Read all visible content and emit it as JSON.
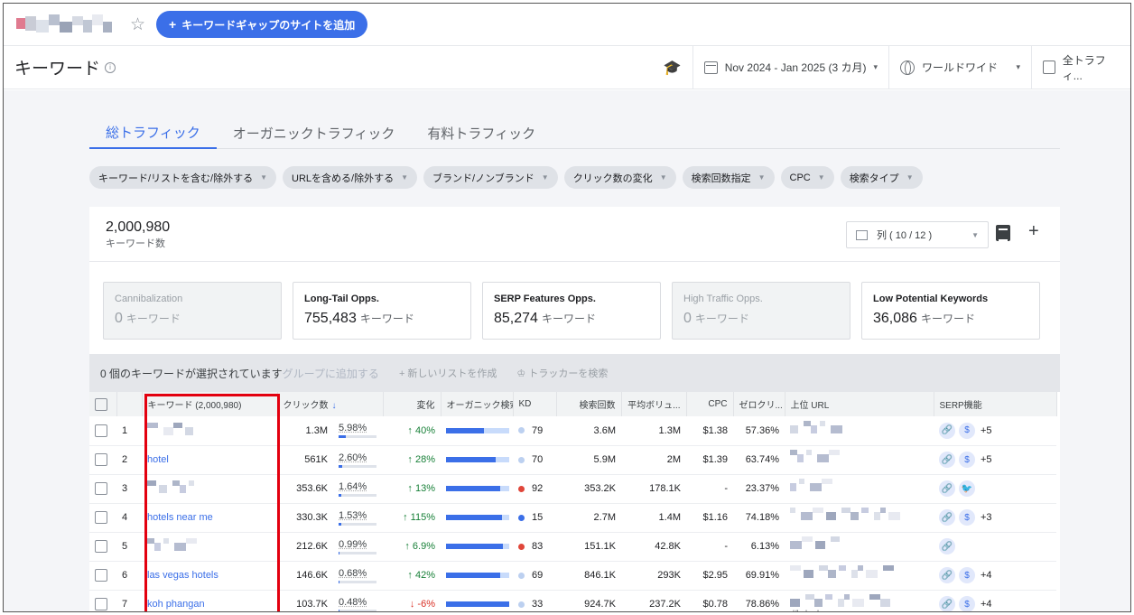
{
  "topbar": {
    "add_gap_label": "キーワードギャップのサイトを追加",
    "add_gap_plus": "+",
    "star_glyph": "☆"
  },
  "header": {
    "title": "キーワード",
    "info_glyph": "i",
    "date_range": "Nov 2024 - Jan 2025 (3 カ月)",
    "country": "ワールドワイド",
    "traffic": "全トラフィ...",
    "caret": "▾"
  },
  "tabs": [
    "総トラフィック",
    "オーガニックトラフィック",
    "有料トラフィック"
  ],
  "filters": [
    "キーワード/リストを含む/除外する",
    "URLを含める/除外する",
    "ブランド/ノンブランド",
    "クリック数の変化",
    "検索回数指定",
    "CPC",
    "検索タイプ"
  ],
  "summary": {
    "count": "2,000,980",
    "count_label": "キーワード数",
    "columns_label": "列 ( 10 / 12 )",
    "add_glyph": "+"
  },
  "opportunities": [
    {
      "title": "Cannibalization",
      "value": "0",
      "unit": "キーワード",
      "disabled": true
    },
    {
      "title": "Long-Tail Opps.",
      "value": "755,483",
      "unit": "キーワード",
      "disabled": false
    },
    {
      "title": "SERP Features Opps.",
      "value": "85,274",
      "unit": "キーワード",
      "disabled": false
    },
    {
      "title": "High Traffic Opps.",
      "value": "0",
      "unit": "キーワード",
      "disabled": true
    },
    {
      "title": "Low Potential Keywords",
      "value": "36,086",
      "unit": "キーワード",
      "disabled": false
    }
  ],
  "selection": {
    "text": "0 個のキーワードが選択されています",
    "group_add": "グループに追加する",
    "new_list": "+ 新しいリストを作成",
    "tracker": "♔ トラッカーを検索"
  },
  "columns": {
    "keyword": "キーワード (2,000,980)",
    "clicks": "クリック数",
    "sort_arrow": "↓",
    "change": "変化",
    "organic": "オーガニック検索 v",
    "kd": "KD",
    "volume": "検索回数",
    "avg_volume": "平均ボリュ...",
    "cpc": "CPC",
    "zero_click": "ゼロクリ...",
    "top_url": "上位 URL",
    "serp": "SERP機能"
  },
  "rows": [
    {
      "num": "1",
      "keyword": "",
      "clicks": "1.3M",
      "share": "5.98%",
      "share_frac": 0.06,
      "change": "↑ 40%",
      "dir": "up",
      "organic_frac": 0.6,
      "kd": "79",
      "kd_color": "#bcd0f0",
      "volume": "3.6M",
      "avg": "1.3M",
      "cpc": "$1.38",
      "zero": "57.36%",
      "url_text": "",
      "serp": [
        "link",
        "dollar"
      ],
      "serp_more": "+5"
    },
    {
      "num": "2",
      "keyword": "hotel",
      "clicks": "561K",
      "share": "2.60%",
      "share_frac": 0.03,
      "change": "↑ 28%",
      "dir": "up",
      "organic_frac": 0.78,
      "kd": "70",
      "kd_color": "#bcd0f0",
      "volume": "5.9M",
      "avg": "2M",
      "cpc": "$1.39",
      "zero": "63.74%",
      "url_text": "",
      "serp": [
        "link",
        "dollar"
      ],
      "serp_more": "+5"
    },
    {
      "num": "3",
      "keyword": "",
      "clicks": "353.6K",
      "share": "1.64%",
      "share_frac": 0.02,
      "change": "↑ 13%",
      "dir": "up",
      "organic_frac": 0.85,
      "kd": "92",
      "kd_color": "#e0463a",
      "volume": "353.2K",
      "avg": "178.1K",
      "cpc": "-",
      "zero": "23.37%",
      "url_text": "",
      "serp": [
        "link",
        "bird"
      ],
      "serp_more": ""
    },
    {
      "num": "4",
      "keyword": "hotels near me",
      "clicks": "330.3K",
      "share": "1.53%",
      "share_frac": 0.02,
      "change": "↑ 115%",
      "dir": "up",
      "organic_frac": 0.88,
      "kd": "15",
      "kd_color": "#3b6fe8",
      "volume": "2.7M",
      "avg": "1.4M",
      "cpc": "$1.16",
      "zero": "74.18%",
      "url_text": "",
      "serp": [
        "link",
        "dollar"
      ],
      "serp_more": "+3"
    },
    {
      "num": "5",
      "keyword": "",
      "clicks": "212.6K",
      "share": "0.99%",
      "share_frac": 0.01,
      "change": "↑ 6.9%",
      "dir": "up",
      "organic_frac": 0.9,
      "kd": "83",
      "kd_color": "#e0463a",
      "volume": "151.1K",
      "avg": "42.8K",
      "cpc": "-",
      "zero": "6.13%",
      "url_text": "",
      "serp": [
        "link"
      ],
      "serp_more": ""
    },
    {
      "num": "6",
      "keyword": "las vegas hotels",
      "clicks": "146.6K",
      "share": "0.68%",
      "share_frac": 0.01,
      "change": "↑ 42%",
      "dir": "up",
      "organic_frac": 0.86,
      "kd": "69",
      "kd_color": "#bcd0f0",
      "volume": "846.1K",
      "avg": "293K",
      "cpc": "$2.95",
      "zero": "69.91%",
      "url_text": "",
      "serp": [
        "link",
        "dollar"
      ],
      "serp_more": "+4"
    },
    {
      "num": "7",
      "keyword": "koh phangan",
      "clicks": "103.7K",
      "share": "0.48%",
      "share_frac": 0.005,
      "change": "↓ -6%",
      "dir": "down",
      "organic_frac": 1.0,
      "kd": "33",
      "kd_color": "#bcd0f0",
      "volume": "924.7K",
      "avg": "237.2K",
      "cpc": "$0.78",
      "zero": "78.86%",
      "url_text": "d/koh-phangan",
      "serp": [
        "link",
        "dollar"
      ],
      "serp_more": "+4"
    }
  ],
  "icons": {
    "link": "🔗",
    "dollar": "$",
    "bird": "🐦"
  }
}
